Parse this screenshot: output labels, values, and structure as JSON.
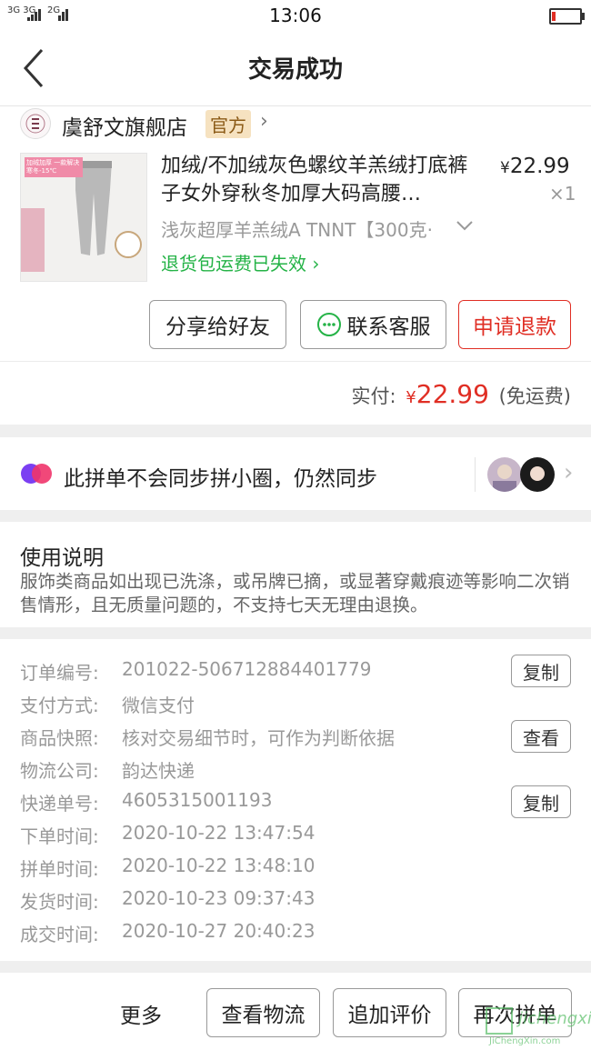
{
  "status_bar": {
    "signal_left": "3G 3G",
    "signal_right": "2G",
    "time": "13:06"
  },
  "nav": {
    "title": "交易成功"
  },
  "shop": {
    "name": "虞舒文旗舰店",
    "badge": "官方"
  },
  "product": {
    "title": "加绒/不加绒灰色螺纹羊羔绒打底裤子女外穿秋冬加厚大码高腰…",
    "price_symbol": "¥",
    "price": "22.99",
    "quantity": "×1",
    "sku": "浅灰超厚羊羔绒A TNNT【300克·",
    "return_note": "退货包运费已失效",
    "thumb_text": "加绒加厚 一款解决寒冬-15℃"
  },
  "actions": {
    "share": "分享给好友",
    "contact": "联系客服",
    "refund": "申请退款"
  },
  "payment": {
    "label": "实付:",
    "symbol": "¥",
    "amount": "22.99",
    "note": "(免运费)"
  },
  "group": {
    "text": "此拼单不会同步拼小圈，仍然同步"
  },
  "usage": {
    "title": "使用说明",
    "body": "服饰类商品如出现已洗涤，或吊牌已摘，或显著穿戴痕迹等影响二次销售情形，且无质量问题的，不支持七天无理由退换。"
  },
  "order_info": [
    {
      "label": "订单编号:",
      "value": "201022-506712884401779",
      "button": "复制"
    },
    {
      "label": "支付方式:",
      "value": "微信支付"
    },
    {
      "label": "商品快照:",
      "value": "核对交易细节时，可作为判断依据",
      "button": "查看"
    },
    {
      "label": "物流公司:",
      "value": "韵达快递"
    },
    {
      "label": "快递单号:",
      "value": "4605315001193",
      "button": "复制"
    },
    {
      "label": "下单时间:",
      "value": "2020-10-22 13:47:54"
    },
    {
      "label": "拼单时间:",
      "value": "2020-10-22 13:48:10"
    },
    {
      "label": "发货时间:",
      "value": "2020-10-23 09:37:43"
    },
    {
      "label": "成交时间:",
      "value": "2020-10-27 20:40:23"
    }
  ],
  "bottom_bar": {
    "more": "更多",
    "logistics": "查看物流",
    "review": "追加评价",
    "rebuy": "再次拼单"
  },
  "watermark": {
    "text": "jichengxin",
    "url": "JiChengXin.com"
  },
  "colors": {
    "accent_red": "#e02e24",
    "green": "#25b347",
    "badge_bg": "#f6e2c0",
    "badge_text": "#8b5a16"
  }
}
